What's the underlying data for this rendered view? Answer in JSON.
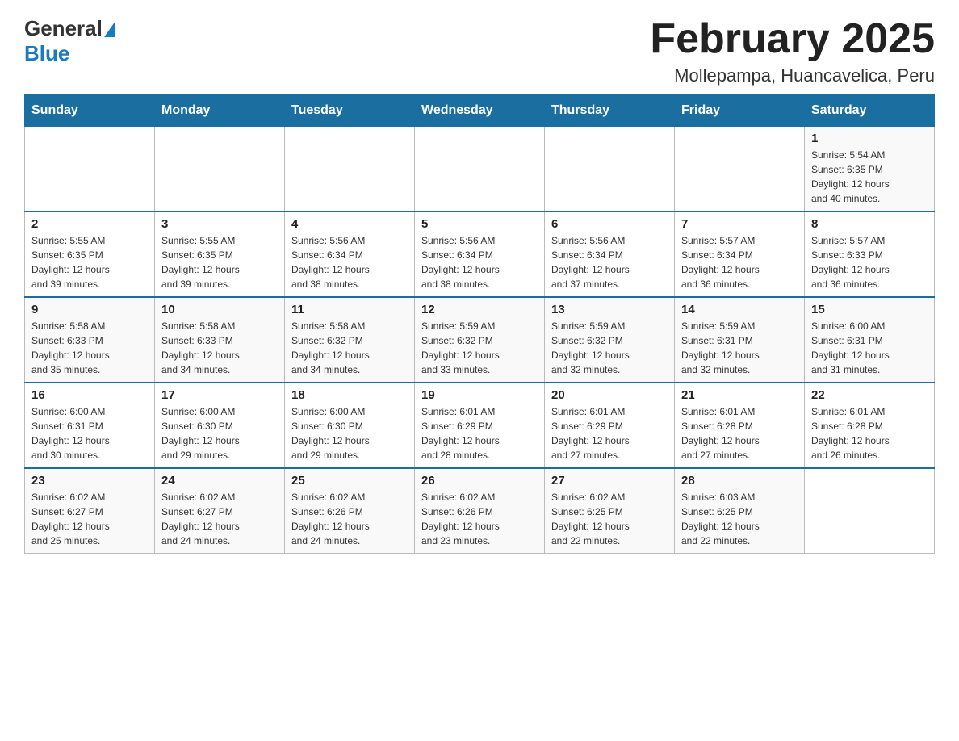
{
  "header": {
    "logo_general": "General",
    "logo_blue": "Blue",
    "month_title": "February 2025",
    "location": "Mollepampa, Huancavelica, Peru"
  },
  "days_of_week": [
    "Sunday",
    "Monday",
    "Tuesday",
    "Wednesday",
    "Thursday",
    "Friday",
    "Saturday"
  ],
  "weeks": [
    [
      {
        "day": "",
        "info": ""
      },
      {
        "day": "",
        "info": ""
      },
      {
        "day": "",
        "info": ""
      },
      {
        "day": "",
        "info": ""
      },
      {
        "day": "",
        "info": ""
      },
      {
        "day": "",
        "info": ""
      },
      {
        "day": "1",
        "info": "Sunrise: 5:54 AM\nSunset: 6:35 PM\nDaylight: 12 hours\nand 40 minutes."
      }
    ],
    [
      {
        "day": "2",
        "info": "Sunrise: 5:55 AM\nSunset: 6:35 PM\nDaylight: 12 hours\nand 39 minutes."
      },
      {
        "day": "3",
        "info": "Sunrise: 5:55 AM\nSunset: 6:35 PM\nDaylight: 12 hours\nand 39 minutes."
      },
      {
        "day": "4",
        "info": "Sunrise: 5:56 AM\nSunset: 6:34 PM\nDaylight: 12 hours\nand 38 minutes."
      },
      {
        "day": "5",
        "info": "Sunrise: 5:56 AM\nSunset: 6:34 PM\nDaylight: 12 hours\nand 38 minutes."
      },
      {
        "day": "6",
        "info": "Sunrise: 5:56 AM\nSunset: 6:34 PM\nDaylight: 12 hours\nand 37 minutes."
      },
      {
        "day": "7",
        "info": "Sunrise: 5:57 AM\nSunset: 6:34 PM\nDaylight: 12 hours\nand 36 minutes."
      },
      {
        "day": "8",
        "info": "Sunrise: 5:57 AM\nSunset: 6:33 PM\nDaylight: 12 hours\nand 36 minutes."
      }
    ],
    [
      {
        "day": "9",
        "info": "Sunrise: 5:58 AM\nSunset: 6:33 PM\nDaylight: 12 hours\nand 35 minutes."
      },
      {
        "day": "10",
        "info": "Sunrise: 5:58 AM\nSunset: 6:33 PM\nDaylight: 12 hours\nand 34 minutes."
      },
      {
        "day": "11",
        "info": "Sunrise: 5:58 AM\nSunset: 6:32 PM\nDaylight: 12 hours\nand 34 minutes."
      },
      {
        "day": "12",
        "info": "Sunrise: 5:59 AM\nSunset: 6:32 PM\nDaylight: 12 hours\nand 33 minutes."
      },
      {
        "day": "13",
        "info": "Sunrise: 5:59 AM\nSunset: 6:32 PM\nDaylight: 12 hours\nand 32 minutes."
      },
      {
        "day": "14",
        "info": "Sunrise: 5:59 AM\nSunset: 6:31 PM\nDaylight: 12 hours\nand 32 minutes."
      },
      {
        "day": "15",
        "info": "Sunrise: 6:00 AM\nSunset: 6:31 PM\nDaylight: 12 hours\nand 31 minutes."
      }
    ],
    [
      {
        "day": "16",
        "info": "Sunrise: 6:00 AM\nSunset: 6:31 PM\nDaylight: 12 hours\nand 30 minutes."
      },
      {
        "day": "17",
        "info": "Sunrise: 6:00 AM\nSunset: 6:30 PM\nDaylight: 12 hours\nand 29 minutes."
      },
      {
        "day": "18",
        "info": "Sunrise: 6:00 AM\nSunset: 6:30 PM\nDaylight: 12 hours\nand 29 minutes."
      },
      {
        "day": "19",
        "info": "Sunrise: 6:01 AM\nSunset: 6:29 PM\nDaylight: 12 hours\nand 28 minutes."
      },
      {
        "day": "20",
        "info": "Sunrise: 6:01 AM\nSunset: 6:29 PM\nDaylight: 12 hours\nand 27 minutes."
      },
      {
        "day": "21",
        "info": "Sunrise: 6:01 AM\nSunset: 6:28 PM\nDaylight: 12 hours\nand 27 minutes."
      },
      {
        "day": "22",
        "info": "Sunrise: 6:01 AM\nSunset: 6:28 PM\nDaylight: 12 hours\nand 26 minutes."
      }
    ],
    [
      {
        "day": "23",
        "info": "Sunrise: 6:02 AM\nSunset: 6:27 PM\nDaylight: 12 hours\nand 25 minutes."
      },
      {
        "day": "24",
        "info": "Sunrise: 6:02 AM\nSunset: 6:27 PM\nDaylight: 12 hours\nand 24 minutes."
      },
      {
        "day": "25",
        "info": "Sunrise: 6:02 AM\nSunset: 6:26 PM\nDaylight: 12 hours\nand 24 minutes."
      },
      {
        "day": "26",
        "info": "Sunrise: 6:02 AM\nSunset: 6:26 PM\nDaylight: 12 hours\nand 23 minutes."
      },
      {
        "day": "27",
        "info": "Sunrise: 6:02 AM\nSunset: 6:25 PM\nDaylight: 12 hours\nand 22 minutes."
      },
      {
        "day": "28",
        "info": "Sunrise: 6:03 AM\nSunset: 6:25 PM\nDaylight: 12 hours\nand 22 minutes."
      },
      {
        "day": "",
        "info": ""
      }
    ]
  ]
}
